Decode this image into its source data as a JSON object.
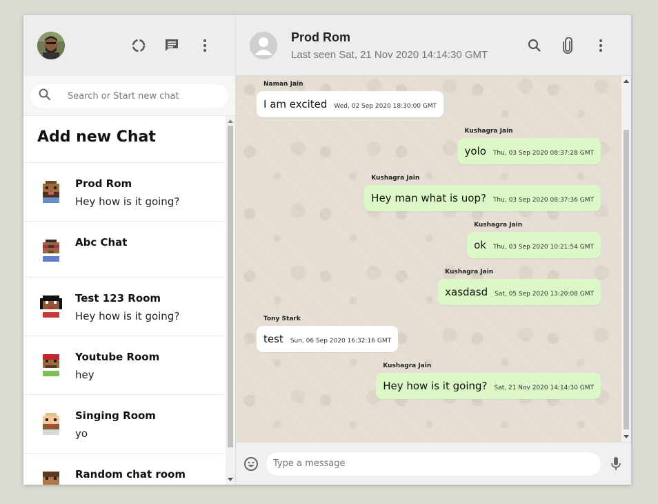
{
  "sidebar": {
    "search": {
      "placeholder": "Search or Start new chat",
      "value": ""
    },
    "add_new_chat": "Add new Chat",
    "chats": [
      {
        "name": "Prod Rom",
        "last_message": "Hey how is it going?",
        "avatar_icon": "pixel-avatar-bald-beard"
      },
      {
        "name": "Abc Chat",
        "last_message": "",
        "avatar_icon": "pixel-avatar-glasses"
      },
      {
        "name": "Test 123 Room",
        "last_message": "Hey how is it going?",
        "avatar_icon": "pixel-avatar-dark-hair"
      },
      {
        "name": "Youtube Room",
        "last_message": "hey",
        "avatar_icon": "pixel-avatar-red-cap"
      },
      {
        "name": "Singing Room",
        "last_message": "yo",
        "avatar_icon": "pixel-avatar-blonde-beard"
      },
      {
        "name": "Random chat room",
        "last_message": "",
        "avatar_icon": "pixel-avatar-brown-hair"
      }
    ]
  },
  "chat_header": {
    "title": "Prod Rom",
    "last_seen": "Last seen Sat, 21 Nov 2020 14:14:30 GMT"
  },
  "messages": [
    {
      "author": "Naman Jain",
      "text": "I am excited",
      "time": "Wed, 02 Sep 2020 18:30:00 GMT",
      "sent": false
    },
    {
      "author": "Kushagra Jain",
      "text": "yolo",
      "time": "Thu, 03 Sep 2020 08:37:28 GMT",
      "sent": true
    },
    {
      "author": "Kushagra Jain",
      "text": "Hey man what is uop?",
      "time": "Thu, 03 Sep 2020 08:37:36 GMT",
      "sent": true
    },
    {
      "author": "Kushagra Jain",
      "text": "ok",
      "time": "Thu, 03 Sep 2020 10:21:54 GMT",
      "sent": true
    },
    {
      "author": "Kushagra Jain",
      "text": "xasdasd",
      "time": "Sat, 05 Sep 2020 13:20:08 GMT",
      "sent": true
    },
    {
      "author": "Tony Stark",
      "text": "test",
      "time": "Sun, 06 Sep 2020 16:32:16 GMT",
      "sent": false
    },
    {
      "author": "Kushagra Jain",
      "text": "Hey how is it going?",
      "time": "Sat, 21 Nov 2020 14:14:30 GMT",
      "sent": true
    }
  ],
  "composer": {
    "placeholder": "Type a message",
    "value": ""
  },
  "colors": {
    "header_bg": "#ededed",
    "sent_bubble": "#dcf8c6",
    "received_bubble": "#ffffff",
    "chat_bg": "#e4ddd3",
    "page_bg": "#dadbd3"
  },
  "icons": {
    "sidebar": [
      "status-icon",
      "new-chat-icon",
      "menu-icon"
    ],
    "chat_header": [
      "search-icon",
      "attach-icon",
      "menu-icon"
    ],
    "footer": [
      "emoji-icon",
      "mic-icon"
    ]
  }
}
